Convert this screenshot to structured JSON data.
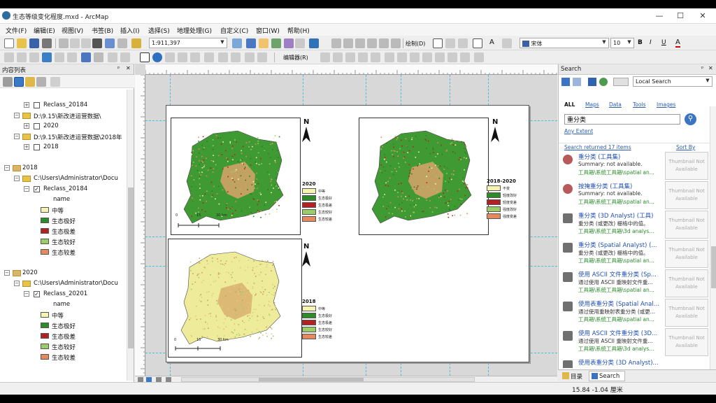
{
  "window": {
    "title": "生态等级变化程度.mxd - ArcMap",
    "minimize": "—",
    "maximize": "☐",
    "close": "✕"
  },
  "menu": [
    "文件(F)",
    "编辑(E)",
    "视图(V)",
    "书签(B)",
    "插入(I)",
    "选择(S)",
    "地理处理(G)",
    "自定义(C)",
    "窗口(W)",
    "帮助(H)"
  ],
  "toolbar": {
    "scale": "1:911,397",
    "draw_label": "绘制(D)",
    "font_name": "宋体",
    "font_size": "10",
    "bold": "B",
    "italic": "I",
    "underline": "U",
    "font_color": "A",
    "text_tool": "A",
    "editor": "编辑器(R)"
  },
  "toc": {
    "title": "内容列表",
    "pin": "ᵖ",
    "close": "✕",
    "rows": [
      {
        "level": 2,
        "type": "layer",
        "checked": false,
        "label": "Reclass_20184"
      },
      {
        "level": 1,
        "type": "folder",
        "label": "D:\\9.15\\新改进运营数据\\"
      },
      {
        "level": 2,
        "type": "layer",
        "checked": false,
        "label": "2020"
      },
      {
        "level": 1,
        "type": "folder",
        "label": "D:\\9.15\\新改进运营数据\\2018年"
      },
      {
        "level": 2,
        "type": "layer",
        "checked": false,
        "label": "2018"
      }
    ],
    "groups": [
      {
        "name": "2018",
        "path": "C:\\Users\\Administrator\\Docu",
        "layer": "Reclass_20184",
        "field": "name",
        "classes": [
          {
            "label": "中等",
            "color": "#f7f3b0"
          },
          {
            "label": "生态极好",
            "color": "#2f8a2a"
          },
          {
            "label": "生态极差",
            "color": "#b32222"
          },
          {
            "label": "生态较好",
            "color": "#9ccc65"
          },
          {
            "label": "生态较差",
            "color": "#e48a5e"
          }
        ]
      },
      {
        "name": "2020",
        "path": "C:\\Users\\Administrator\\Docu",
        "layer": "Reclass_20201",
        "field": "name",
        "classes": [
          {
            "label": "中等",
            "color": "#f7f3b0"
          },
          {
            "label": "生态极好",
            "color": "#2f8a2a"
          },
          {
            "label": "生态极差",
            "color": "#b32222"
          },
          {
            "label": "生态较好",
            "color": "#9ccc65"
          },
          {
            "label": "生态较差",
            "color": "#e48a5e"
          }
        ]
      }
    ]
  },
  "layout": {
    "maps": [
      {
        "north": "N",
        "legend_title": "2020",
        "legend": [
          "中等",
          "生态极好",
          "生态极差",
          "生态较好",
          "生态较差"
        ],
        "legend_colors": [
          "#f7f3b0",
          "#2f8a2a",
          "#b32222",
          "#9ccc65",
          "#e48a5e"
        ],
        "scale": [
          "0",
          "15",
          "30 km"
        ],
        "fill_main": "#3f9a34",
        "fill_core": "#d9a36c"
      },
      {
        "north": "N",
        "legend_title": "2018-2020",
        "legend": [
          "不变",
          "轻度改好",
          "轻度变差",
          "强度改好",
          "强度变差"
        ],
        "legend_colors": [
          "#f7f3b0",
          "#2f8a2a",
          "#b32222",
          "#9ccc65",
          "#e48a5e"
        ],
        "scale": [
          "0",
          "15",
          "30 km"
        ],
        "fill_main": "#3f9a34",
        "fill_core": "#d9a36c"
      },
      {
        "north": "N",
        "legend_title": "2018",
        "legend": [
          "中等",
          "生态极好",
          "生态极差",
          "生态较好",
          "生态较差"
        ],
        "legend_colors": [
          "#f7f3b0",
          "#2f8a2a",
          "#b32222",
          "#9ccc65",
          "#e48a5e"
        ],
        "scale": [
          "0",
          "15",
          "30 km"
        ],
        "fill_main": "#eeec9a",
        "fill_core": "#d9b070"
      }
    ]
  },
  "search": {
    "title": "Search",
    "scope": "Local Search",
    "tabs": [
      "ALL",
      "Maps",
      "Data",
      "Tools",
      "Images"
    ],
    "query": "重分类",
    "extent": "Any Extent",
    "returned": "Search returned 17 items",
    "sort": "Sort By",
    "thumb_text": "Thumbnail Not Available",
    "results": [
      {
        "title": "重分类 (工具集)",
        "summary": "Summary: not available.",
        "path": "工具箱\\系统工具箱\\spatial an...",
        "icon": "toolset"
      },
      {
        "title": "按掩重分类 (工具集)",
        "summary": "Summary: not available.",
        "path": "工具箱\\系统工具箱\\spatial an...",
        "icon": "toolset"
      },
      {
        "title": "重分类 (3D Analyst) (工具)",
        "summary": "重分类 (或更改) 栅格中的值。",
        "path": "工具箱\\系统工具箱\\3d analys...",
        "icon": "tool"
      },
      {
        "title": "重分类 (Spatial Analyst) (...",
        "summary": "重分类 (或更改) 栅格中的值。",
        "path": "工具箱\\系统工具箱\\spatial an...",
        "icon": "tool"
      },
      {
        "title": "使用 ASCII 文件重分类 (Sp...",
        "summary": "通过使用 ASCII 重映射文件重...",
        "path": "工具箱\\系统工具箱\\spatial an...",
        "icon": "tool"
      },
      {
        "title": "使用表重分类 (Spatial Anal...",
        "summary": "通过使用重映射表重分类 (或更...",
        "path": "工具箱\\系统工具箱\\spatial an...",
        "icon": "tool"
      },
      {
        "title": "使用 ASCII 文件重分类 (3D...",
        "summary": "通过使用 ASCII 重映射文件重...",
        "path": "工具箱\\系统工具箱\\3d analys...",
        "icon": "tool"
      },
      {
        "title": "使用表重分类 (3D Analyst)...",
        "summary": "",
        "path": "",
        "icon": "tool"
      }
    ],
    "page_marker": "1",
    "bottom_tabs": [
      "目录",
      "Search"
    ]
  },
  "status": {
    "coords": "15.84  -1.04 厘米"
  },
  "colors": {
    "accent": "#2a5db0",
    "guide": "#4bc0d8"
  }
}
